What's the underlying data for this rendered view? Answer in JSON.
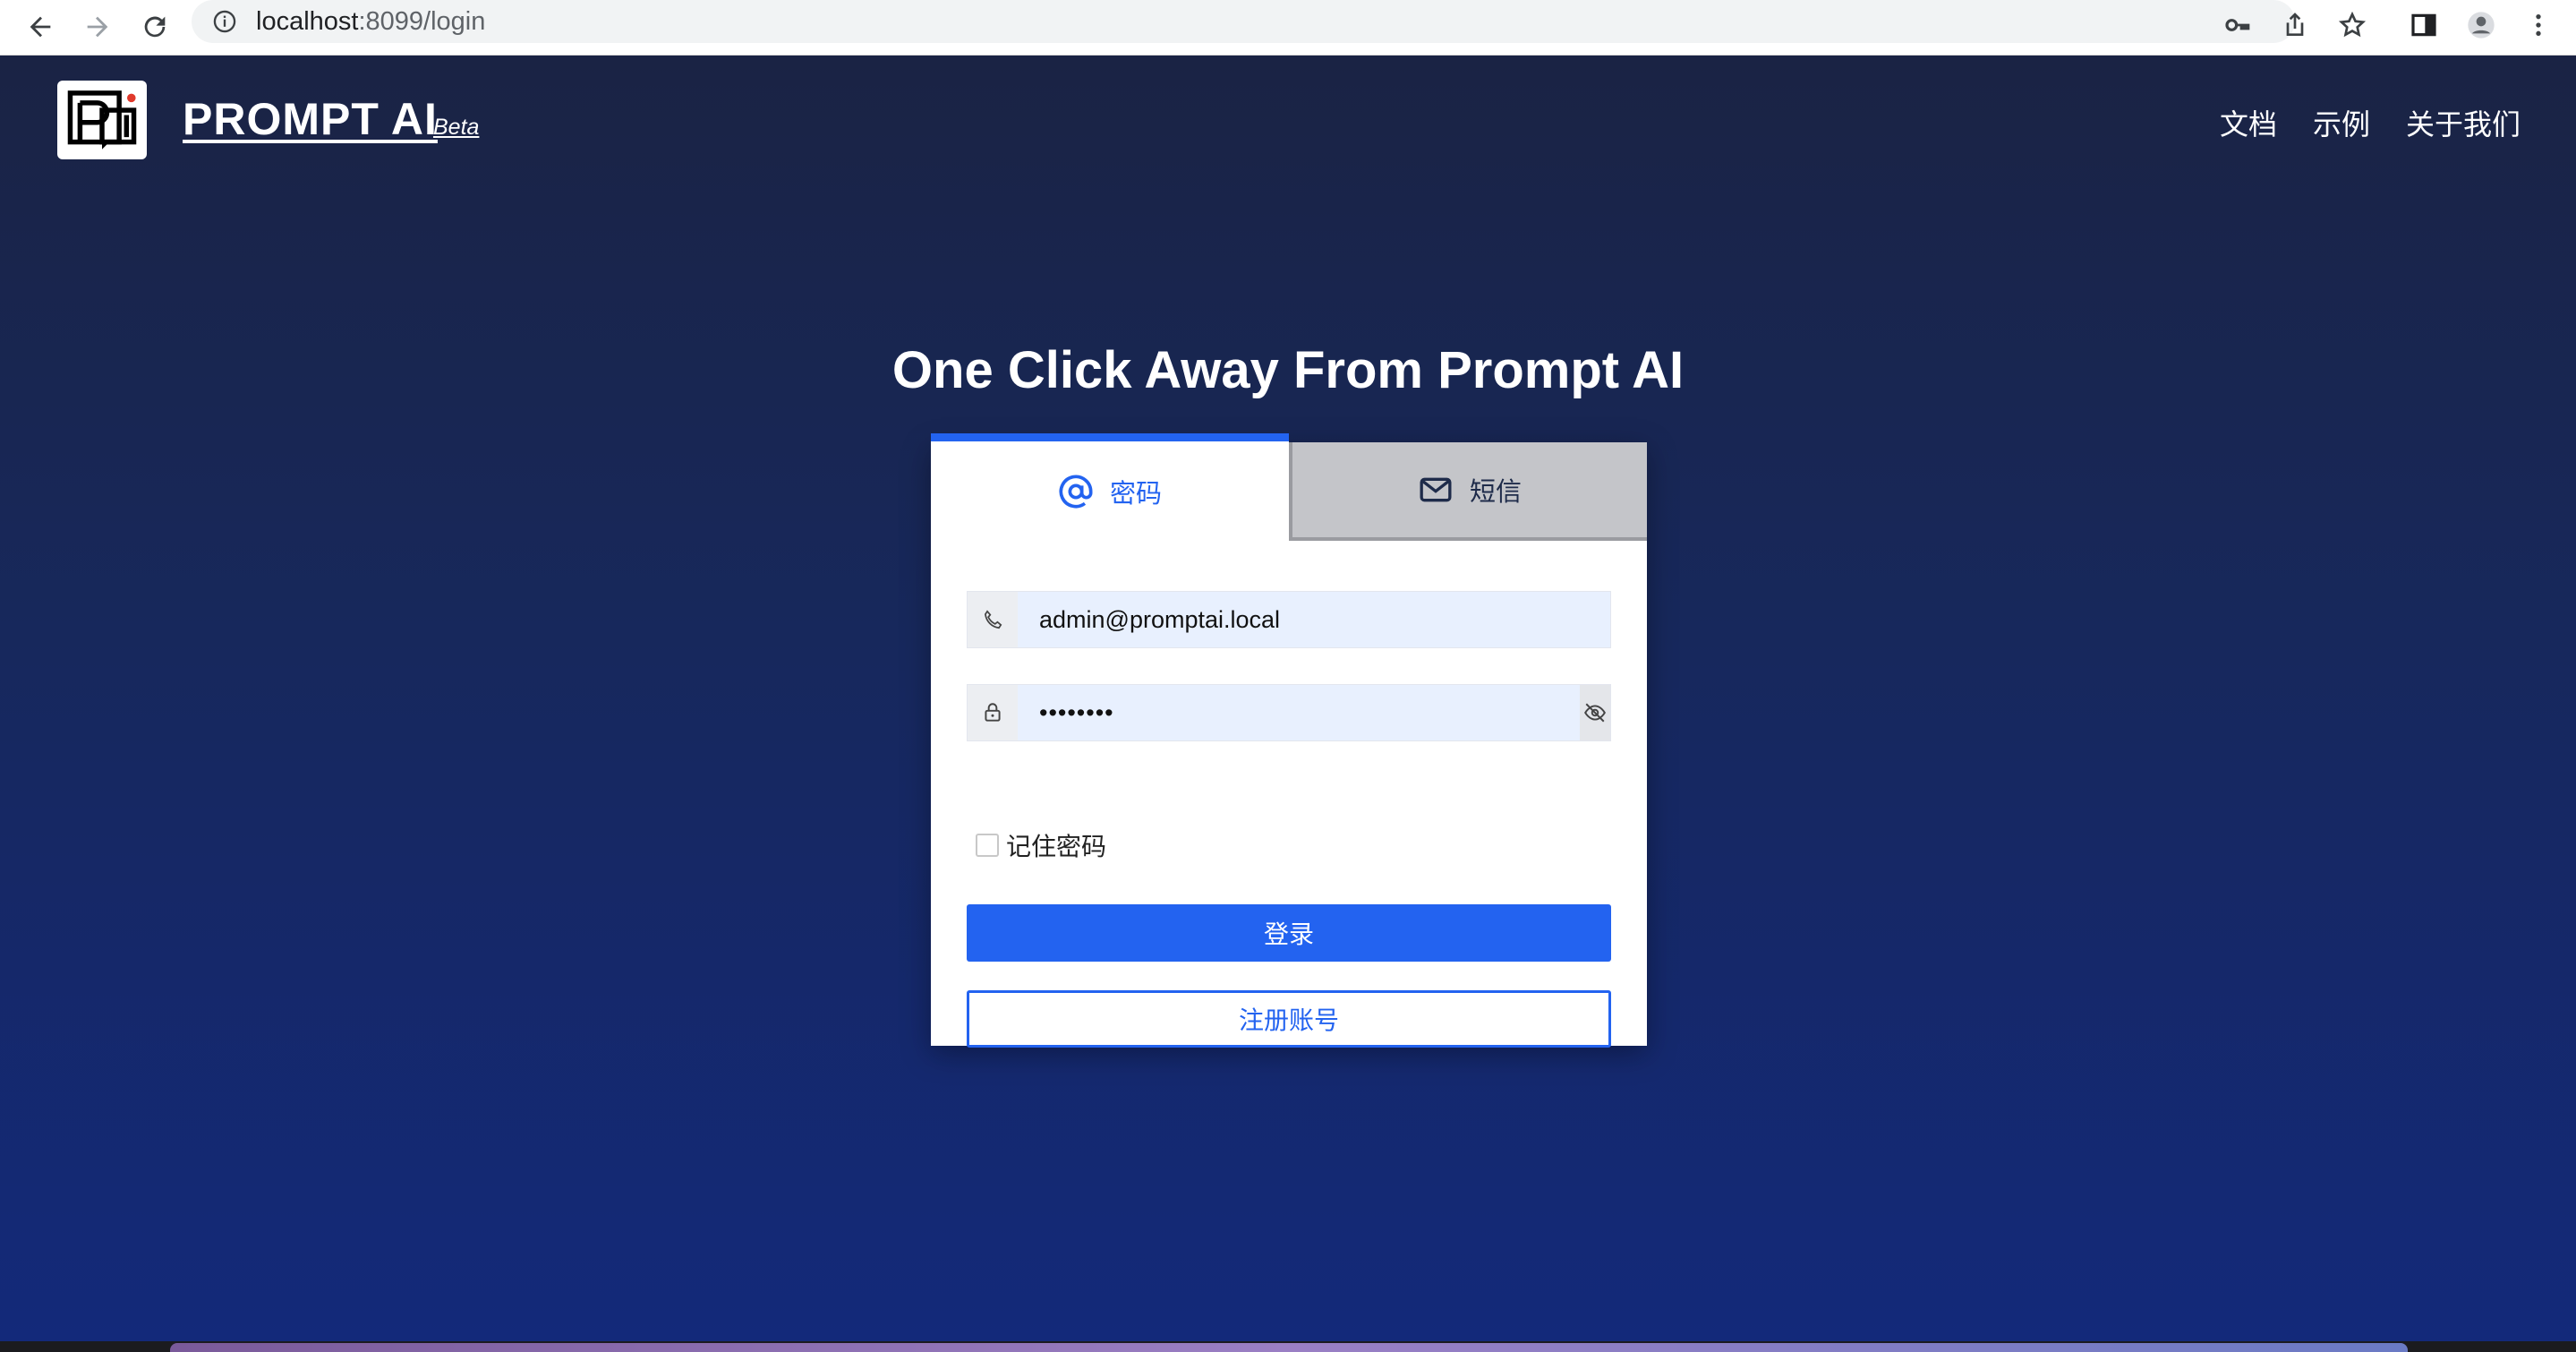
{
  "browser": {
    "url_host": "localhost",
    "url_path": ":8099/login",
    "icons": [
      "back-arrow-icon",
      "forward-arrow-icon",
      "reload-icon",
      "info-icon",
      "key-icon",
      "share-icon",
      "star-icon",
      "sidepanel-icon",
      "profile-icon",
      "menu-dots-icon"
    ]
  },
  "header": {
    "brand": "PROMPT AI",
    "beta": "Beta",
    "nav": [
      "文档",
      "示例",
      "关于我们"
    ]
  },
  "hero": {
    "title": "One Click Away From Prompt AI"
  },
  "login": {
    "tabs": [
      {
        "label": "密码",
        "icon": "at-sign-icon",
        "active": true
      },
      {
        "label": "短信",
        "icon": "envelope-icon",
        "active": false
      }
    ],
    "account_value": "admin@promptai.local",
    "password_value": "••••••••",
    "remember_label": "记住密码",
    "login_button": "登录",
    "register_button": "注册账号"
  },
  "colors": {
    "primary": "#2363f0",
    "background_top": "#1a2344",
    "background_bottom": "#13297a"
  }
}
